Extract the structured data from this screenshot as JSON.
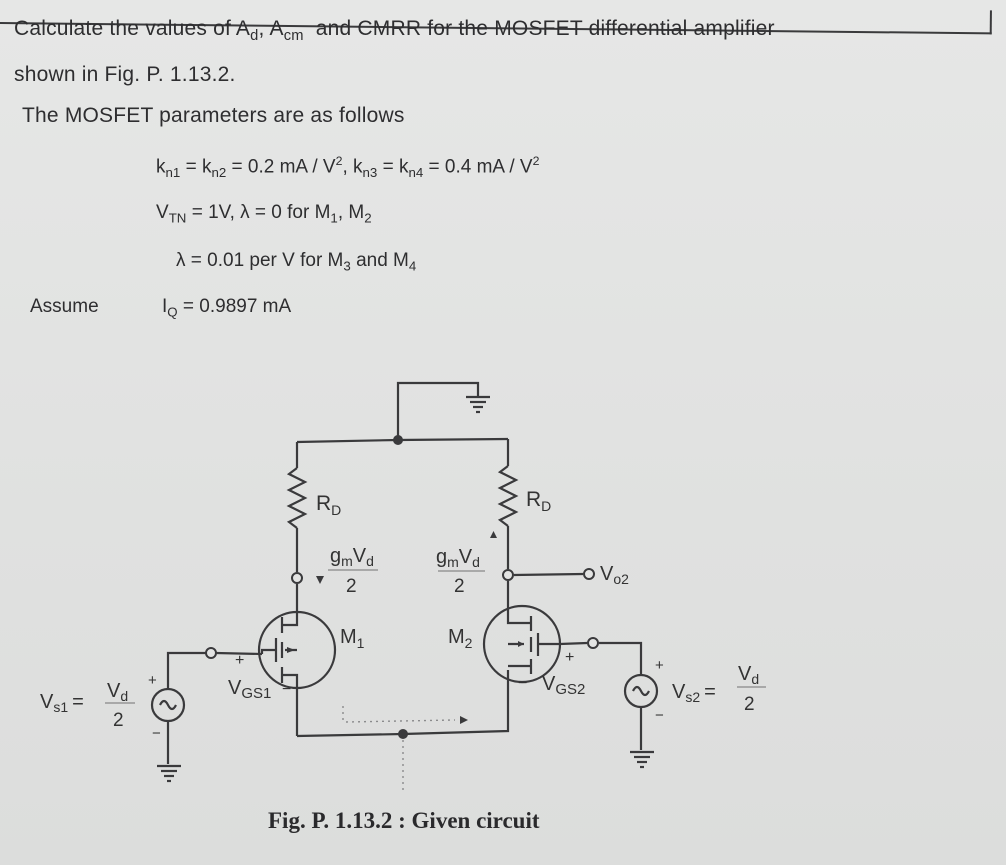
{
  "problem": {
    "intro_1": "Calculate the values of A",
    "ad_sub": "d",
    "comma": ",",
    "acm_a": "A",
    "acm_sub": "cm",
    "intro_2": "and CMRR for the MOSFET differential amplifier",
    "intro_3": "shown in Fig. P. 1.13.2.",
    "params_heading": "The MOSFET parameters are as follows"
  },
  "parameters": {
    "line1": {
      "k": "k",
      "n1": "n1",
      "eq1": " = k",
      "n2": "n2",
      "val1": " = 0.2 mA / V",
      "sq": "2",
      "sep": ", k",
      "n3": "n3",
      "eq2": " = k",
      "n4": "n4",
      "val2": " = 0.4 mA / V",
      "sq2": "2"
    },
    "line2": {
      "v": "V",
      "tn": "TN",
      "text": " = 1V, λ = 0 for M",
      "s1": "1",
      "comma": ", M",
      "s2": "2"
    },
    "line3": {
      "text": "λ = 0.01 per V for M",
      "s3": "3",
      "and": " and M",
      "s4": "4"
    },
    "line4": {
      "assume": "Assume",
      "i": "I",
      "q": "Q",
      "text": " = 0.9897 mA"
    }
  },
  "circuit": {
    "rd_left": "R",
    "rd_left_sub": "D",
    "rd_right": "R",
    "rd_right_sub": "D",
    "gm_num": "g",
    "gm_sub": "m",
    "gm_v": "V",
    "gm_vsub": "d",
    "gm_den": "2",
    "m1": "M",
    "m1_sub": "1",
    "m2": "M",
    "m2_sub": "2",
    "vo2": "V",
    "vo2_sub": "o2",
    "vgs1": "V",
    "vgs1_sub": "GS1",
    "vgs2": "V",
    "vgs2_sub": "GS2",
    "vs1": "V",
    "vs1_sub": "s1",
    "vs2": "V",
    "vs2_sub": "s2",
    "eq": "=",
    "vd": "V",
    "vd_sub": "d",
    "two": "2",
    "plus": "+",
    "minus": "−"
  },
  "caption": "Fig. P. 1.13.2 : Given circuit"
}
